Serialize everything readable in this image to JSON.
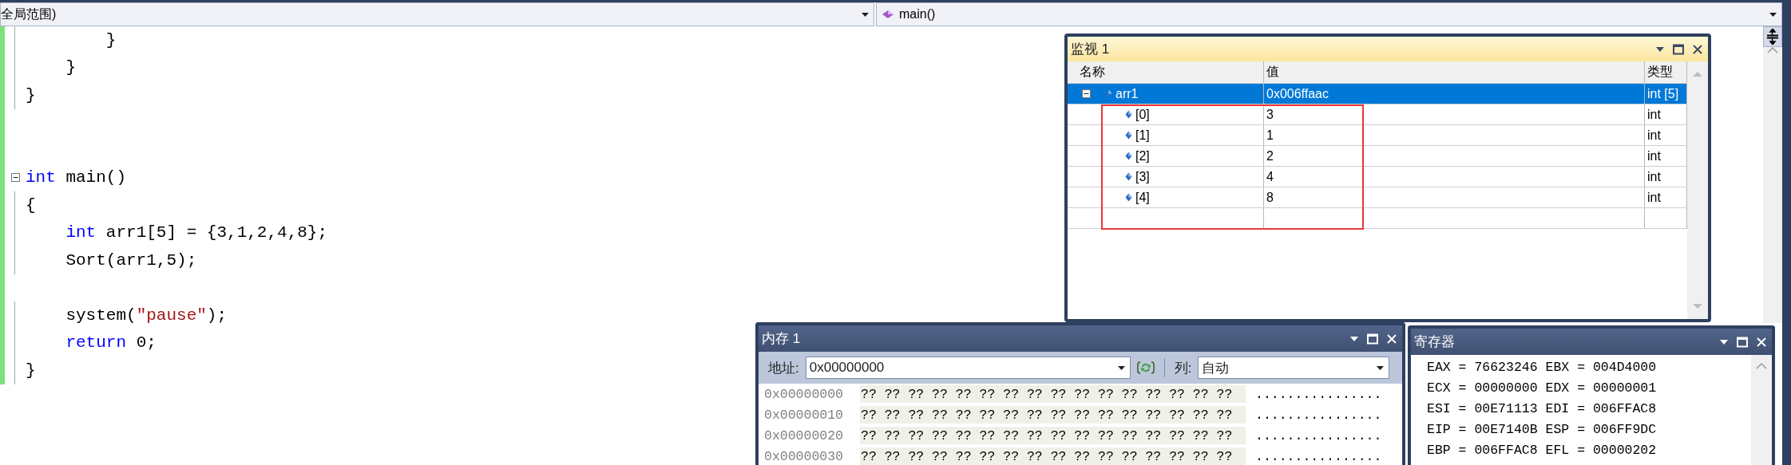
{
  "nav_bar": {
    "scope": "全局范围)",
    "function": "main()"
  },
  "code_lines": [
    {
      "foldable": false,
      "tokens": [
        {
          "kind": "text",
          "text": "        }"
        }
      ]
    },
    {
      "foldable": false,
      "tokens": [
        {
          "kind": "text",
          "text": "    }"
        }
      ]
    },
    {
      "foldable": false,
      "tokens": [
        {
          "kind": "text",
          "text": "}"
        }
      ]
    },
    {
      "foldable": false
    },
    {
      "foldable": false
    },
    {
      "foldable": true,
      "tokens": [
        {
          "kind": "keyword",
          "text": "int"
        },
        {
          "kind": "text",
          "text": " main()"
        }
      ]
    },
    {
      "foldable": false,
      "tokens": [
        {
          "kind": "text",
          "text": "{"
        }
      ]
    },
    {
      "foldable": false,
      "tokens": [
        {
          "kind": "keyword",
          "text": "    int"
        },
        {
          "kind": "text",
          "text": " arr1[5] = {3,1,2,4,8};"
        }
      ]
    },
    {
      "foldable": false,
      "tokens": [
        {
          "kind": "text",
          "text": "    Sort(arr1,5);"
        }
      ]
    },
    {
      "foldable": false
    },
    {
      "foldable": false,
      "tokens": [
        {
          "kind": "text",
          "text": "    system("
        },
        {
          "kind": "string",
          "text": "\"pause\""
        },
        {
          "kind": "text",
          "text": ");"
        }
      ]
    },
    {
      "foldable": false,
      "tokens": [
        {
          "kind": "keyword",
          "text": "    return"
        },
        {
          "kind": "text",
          "text": " 0;"
        }
      ]
    },
    {
      "foldable": false,
      "tokens": [
        {
          "kind": "text",
          "text": "}"
        }
      ]
    }
  ],
  "watch": {
    "title": "监视 1",
    "columns": [
      "名称",
      "值",
      "类型"
    ],
    "rows": [
      {
        "name": "arr1",
        "value": "0x006ffaac",
        "type": "int [5]",
        "selected": true,
        "expanded": true,
        "children": [
          {
            "name": "[0]",
            "value": "3",
            "type": "int",
            "selected": false
          },
          {
            "name": "[1]",
            "value": "1",
            "type": "int",
            "selected": false
          },
          {
            "name": "[2]",
            "value": "2",
            "type": "int",
            "selected": false
          },
          {
            "name": "[3]",
            "value": "4",
            "type": "int",
            "selected": false
          },
          {
            "name": "[4]",
            "value": "8",
            "type": "int",
            "selected": false
          }
        ]
      }
    ]
  },
  "memory": {
    "title": "内存 1",
    "address_label": "地址:",
    "address": "0x00000000",
    "columns_label": "列:",
    "columns_value": "自动",
    "rows": [
      {
        "address": "0x00000000",
        "bytes": "?? ?? ?? ?? ?? ?? ?? ?? ?? ?? ?? ?? ?? ?? ?? ??",
        "chars": "................"
      },
      {
        "address": "0x00000010",
        "bytes": "?? ?? ?? ?? ?? ?? ?? ?? ?? ?? ?? ?? ?? ?? ?? ??",
        "chars": "................"
      },
      {
        "address": "0x00000020",
        "bytes": "?? ?? ?? ?? ?? ?? ?? ?? ?? ?? ?? ?? ?? ?? ?? ??",
        "chars": "................"
      },
      {
        "address": "0x00000030",
        "bytes": "?? ?? ?? ?? ?? ?? ?? ?? ?? ?? ?? ?? ?? ?? ?? ??",
        "chars": "................"
      }
    ]
  },
  "registers": {
    "title": "寄存器",
    "lines": [
      "EAX = 76623246 EBX = 004D4000",
      "ECX = 00000000 EDX = 00000001",
      "ESI = 00E71113 EDI = 006FFAC8",
      "EIP = 00E7140B ESP = 006FF9DC",
      "EBP = 006FFAC8 EFL = 00000202"
    ]
  }
}
